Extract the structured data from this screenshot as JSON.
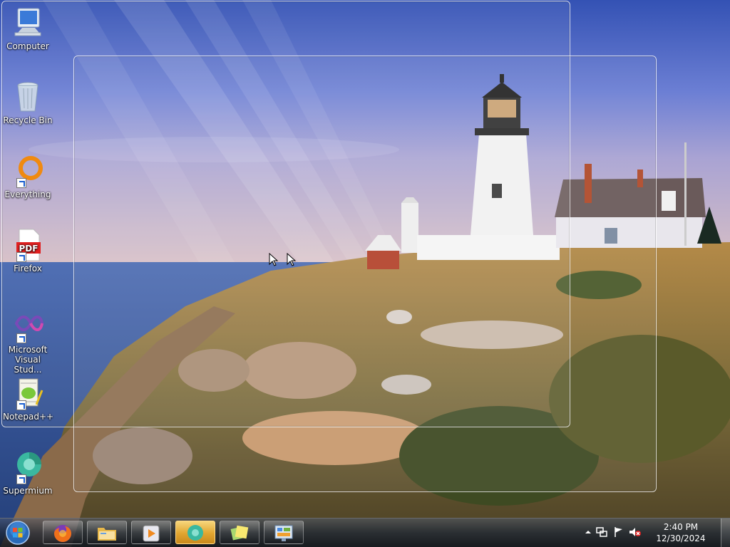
{
  "desktop": {
    "icons": [
      {
        "label": "Computer",
        "icon": "computer-icon"
      },
      {
        "label": "Recycle Bin",
        "icon": "recycle-bin-icon"
      },
      {
        "label": "Everything",
        "icon": "everything-icon"
      },
      {
        "label": "Firefox",
        "icon": "pdf-icon"
      },
      {
        "label": "Microsoft Visual Stud...",
        "icon": "visual-studio-icon"
      },
      {
        "label": "Notepad++",
        "icon": "notepadpp-icon"
      },
      {
        "label": "Supermium",
        "icon": "supermium-icon"
      }
    ]
  },
  "taskbar": {
    "buttons": [
      {
        "name": "firefox",
        "icon": "firefox-icon"
      },
      {
        "name": "file-explorer",
        "icon": "folder-icon"
      },
      {
        "name": "media-player",
        "icon": "media-player-icon"
      },
      {
        "name": "supermium",
        "icon": "supermium-icon",
        "active": true
      },
      {
        "name": "sticky-notes",
        "icon": "sticky-notes-icon"
      },
      {
        "name": "control-panel",
        "icon": "control-panel-icon"
      }
    ]
  },
  "tray": {
    "time": "2:40 PM",
    "date": "12/30/2024",
    "icons": [
      "chevron-up-icon",
      "network-icon",
      "flag-icon",
      "volume-muted-icon"
    ]
  },
  "colors": {
    "taskbar": "#1c2433",
    "active_button": "#e1a530",
    "window_border": "#ffffff"
  }
}
